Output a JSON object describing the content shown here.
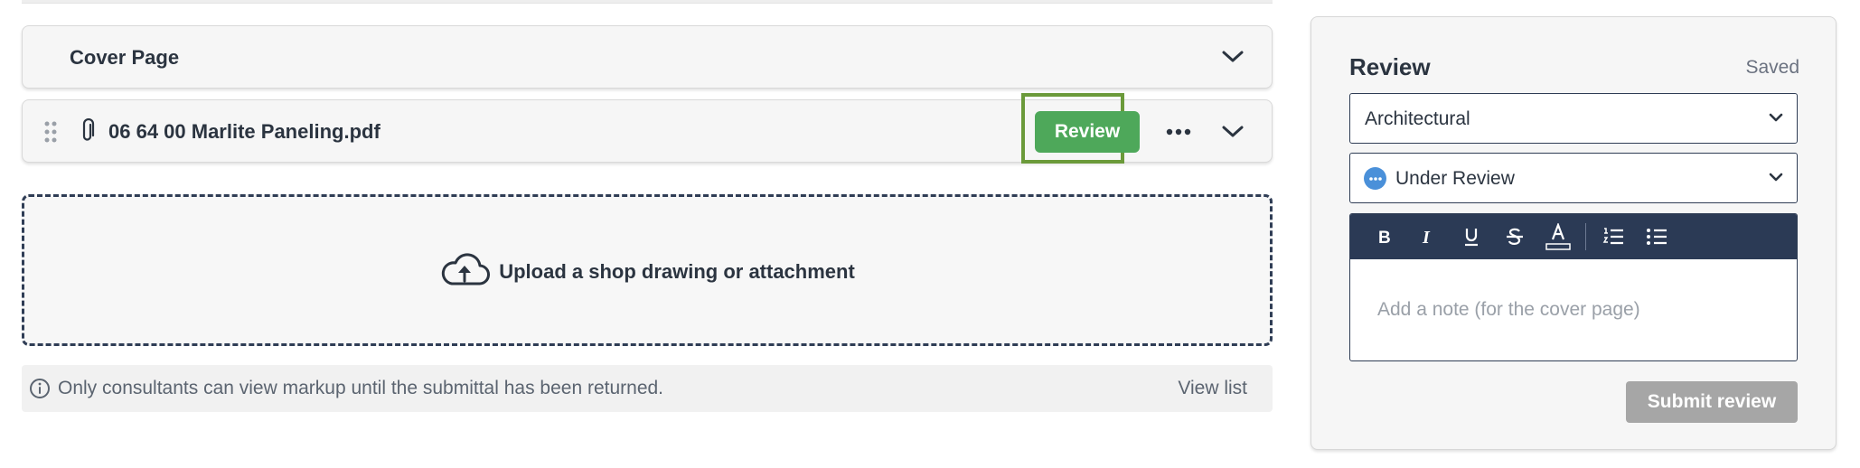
{
  "sections": {
    "cover_page": {
      "title": "Cover Page"
    },
    "attachment": {
      "file_name": "06 64 00 Marlite Paneling.pdf",
      "review_label": "Review"
    }
  },
  "upload": {
    "label": "Upload a shop drawing or attachment"
  },
  "notice": {
    "text": "Only consultants can view markup until the submittal has been returned.",
    "link": "View list"
  },
  "review_panel": {
    "title": "Review",
    "save_status": "Saved",
    "discipline": {
      "selected": "Architectural"
    },
    "status": {
      "selected": "Under Review",
      "color": "#4a90d9"
    },
    "editor": {
      "toolbar": [
        "bold",
        "italic",
        "underline",
        "strikethrough",
        "text-color",
        "ordered-list",
        "bullet-list"
      ],
      "placeholder": "Add a note (for the cover page)"
    },
    "submit_label": "Submit review"
  },
  "colors": {
    "review_button": "#4ea85a",
    "highlight_box": "#6b9a3a",
    "toolbar_bg": "#2b3a55",
    "submit_disabled": "#a6a6a6"
  }
}
